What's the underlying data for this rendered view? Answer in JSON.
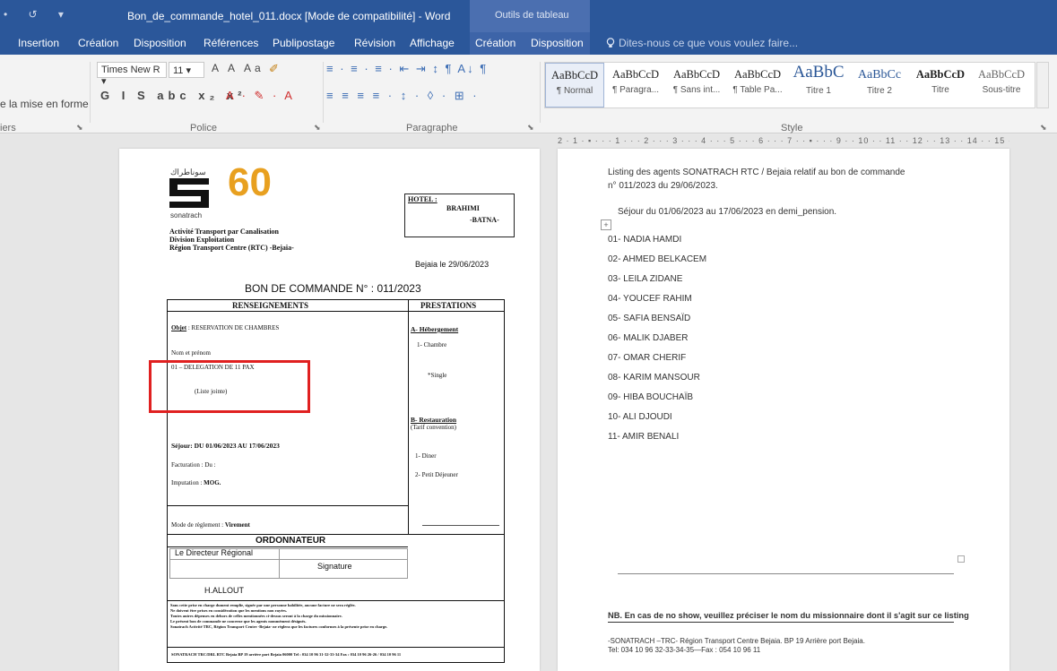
{
  "titlebar": {
    "quick_access": "•  ↺  ▾",
    "document_title": "Bon_de_commande_hotel_011.docx [Mode de compatibilité] - Word",
    "context_group": "Outils de tableau"
  },
  "tabs": [
    "Insertion",
    "Création",
    "Disposition",
    "Références",
    "Publipostage",
    "Révision",
    "Affichage",
    "Création",
    "Disposition"
  ],
  "tell_me": "Dites-nous ce que vous voulez faire...",
  "ribbon": {
    "clipboard_tail": "e la mise en forme",
    "clipboard_label": "iers",
    "font_name": "Times New R",
    "font_size": "11",
    "font_row1_glyphs": "A A Aa",
    "font_row2_glyphs": "G I S abc x₂ x²",
    "font_color_glyphs": "A · ✎ · A",
    "font_group": "Police",
    "paragraph_row1": "≡ · ≡ · ≡ ·  ⇤ ⇥  ↕ ¶  A↓ ¶",
    "paragraph_row2": "≡ ≡ ≡ ≡ ·  ↕ ·  ◊ · ⊞ ·",
    "paragraph_group": "Paragraphe",
    "style_group": "Style",
    "styles": [
      {
        "sample": "AaBbCcD",
        "name": "¶ Normal"
      },
      {
        "sample": "AaBbCcD",
        "name": "¶ Paragra..."
      },
      {
        "sample": "AaBbCcD",
        "name": "¶ Sans int..."
      },
      {
        "sample": "AaBbCcD",
        "name": "¶ Table Pa..."
      },
      {
        "sample": "AaBbC",
        "name": "Titre 1"
      },
      {
        "sample": "AaBbCc",
        "name": "Titre 2"
      },
      {
        "sample": "AaBbCcD",
        "name": "Titre"
      },
      {
        "sample": "AaBbCcD",
        "name": "Sous-titre"
      }
    ]
  },
  "ruler": "2 · 1 · ▪ · · · 1 · · · 2 · · · 3 · · · 4 · · · 5 · · · 6 · · · 7 · · ▪ · · · 9 · · 10 · · 11 · · 12 · · 13 · · 14 · · 15 · · ▪ · · 17 · · 18",
  "page1": {
    "logo_arabic": "سوناطراك",
    "logo_word": "sonatrach",
    "logo_sixty": "60",
    "org_lines": [
      "Activité Transport par Canalisation",
      "Division Exploitation",
      "Région Transport Centre (RTC) -Bejaia-"
    ],
    "hotel_label": "HOTEL :",
    "hotel_name": "BRAHIMI",
    "hotel_city": "-BATNA-",
    "place_date": "Bejaia le 29/06/2023",
    "form_title": "BON DE COMMANDE N° : 011/2023",
    "col_left": "RENSEIGNEMENTS",
    "col_right": "PRESTATIONS",
    "objet_label": "Objet",
    "objet_value": ": RESERVATION DE CHAMBRES",
    "nom_prenom": "Nom      et      prénom",
    "delegation": "01 – DELEGATION DE 11 PAX",
    "liste": "(Liste jointe)",
    "sejour": "Séjour: DU 01/06/2023 AU 17/06/2023",
    "facturation": "Facturation :                    Du :",
    "imputation_label": "Imputation :",
    "imputation_value": "MOG.",
    "hebergement": "A- Hébergement",
    "chambre": "1-  Chambre",
    "single": "*Single",
    "restauration": "B- Restauration",
    "tarif": "(Tarif convention)",
    "diner": "1-  Diner",
    "petit_dej": "2-  Petit Déjeuner",
    "mode_label": "Mode de règlement :",
    "mode_value": "Virement",
    "ordonnateur": "ORDONNATEUR",
    "directeur": "Le Directeur Régional",
    "signature": "Signature",
    "signataire": "H.ALLOUT",
    "notes": [
      "Sans cette prise en charge dument remplie, signée par une personne habilitée, aucune facture ne sera réglée.",
      "Ne doivent être prises en considération que les mentions non rayées.",
      "Toutes autres dépenses en dehors de celles mentionnées ci-dessus seront à la charge du missionnaire.",
      "Le présent bon de commande ne concerne que les agents nommément désignés.",
      "Sonatrach Activité TRC, Région Transport Centre -Bejaia- ne règlera que les factures conformes à la présente prise en charge."
    ],
    "footer": "SONATRACH TRC/DRL RTC Bejaia BP 19 arrière port Bejaia 06000 Tel : 034 10 96 31-32-33-34 Fax : 034 10 96 26-26 / 034 10 96 11"
  },
  "page2": {
    "intro_line1": "Listing des agents SONATRACH RTC / Bejaia relatif au bon de commande",
    "intro_line2": "n° 011/2023 du 29/06/2023.",
    "sejour": "Séjour du 01/06/2023 au 17/06/2023 en demi_pension.",
    "agents": [
      "01- NADIA HAMDI",
      "02- AHMED BELKACEM",
      "03- LEILA ZIDANE",
      "04- YOUCEF RAHIM",
      "05- SAFIA BENSAÏD",
      "06- MALIK DJABER",
      "07- OMAR CHERIF",
      "08- KARIM MANSOUR",
      "09- HIBA BOUCHAÏB",
      "10- ALI DJOUDI",
      "11- AMIR BENALI"
    ],
    "nb": "NB. En cas de no show, veuillez préciser le nom du missionnaire dont il s'agit sur ce listing",
    "footer1": "-SONATRACH –TRC- Région Transport Centre Bejaia. BP 19 Arrière port Bejaia.",
    "footer2": "Tel: 034 10 96 32-33-34-35—Fax : 054 10 96 11"
  }
}
